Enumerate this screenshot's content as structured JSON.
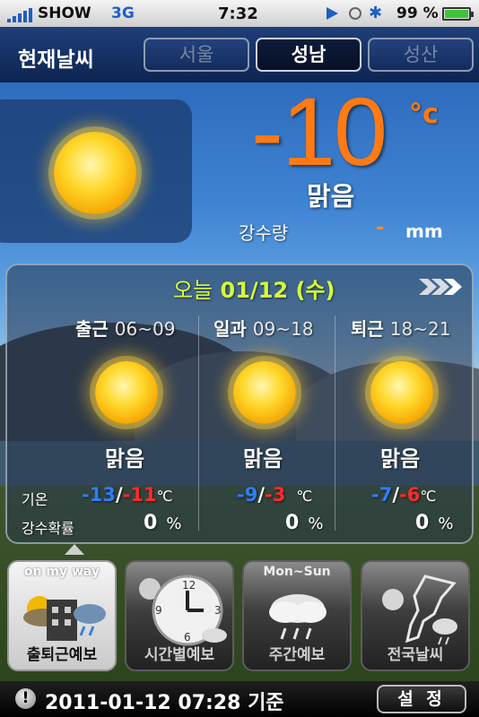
{
  "status_bar": {
    "carrier": "SHOW",
    "network": "3G",
    "time": "7:32",
    "battery_text": "99 %"
  },
  "header": {
    "title": "현재날씨",
    "city_tabs": [
      {
        "label": "서울",
        "active": false
      },
      {
        "label": "성남",
        "active": true
      },
      {
        "label": "성산",
        "active": false
      }
    ]
  },
  "current": {
    "temperature": "-10",
    "unit": "°c",
    "condition": "맑음",
    "precip_label": "강수량",
    "precip_value": "-",
    "precip_unit": "mm"
  },
  "today": {
    "label": "오늘",
    "date": "01/12 (수)",
    "row_labels": {
      "temp": "기온",
      "precip_prob": "강수확률"
    },
    "columns": [
      {
        "period": "출근",
        "hours": "06~09",
        "condition": "맑음",
        "low": "-13",
        "high": "-11",
        "deg": "℃",
        "prob": "0",
        "prob_unit": "%"
      },
      {
        "period": "일과",
        "hours": "09~18",
        "condition": "맑음",
        "low": "-9",
        "high": "-3",
        "deg": "℃",
        "prob": "0",
        "prob_unit": "%"
      },
      {
        "period": "퇴근",
        "hours": "18~21",
        "condition": "맑음",
        "low": "-7",
        "high": "-6",
        "deg": "℃",
        "prob": "0",
        "prob_unit": "%"
      }
    ]
  },
  "tabs": [
    {
      "label": "출퇴근예보",
      "top": "on my way",
      "active": true,
      "icon": "commute-weather-icon"
    },
    {
      "label": "시간별예보",
      "top": "",
      "active": false,
      "icon": "clock-weather-icon"
    },
    {
      "label": "주간예보",
      "top": "Mon~Sun",
      "active": false,
      "icon": "rain-cloud-icon"
    },
    {
      "label": "전국날씨",
      "top": "",
      "active": false,
      "icon": "korea-map-weather-icon"
    }
  ],
  "footer": {
    "timestamp": "2011-01-12 07:28 기준",
    "settings_label": "설 정"
  },
  "colors": {
    "accent_orange": "#ff7a14",
    "low_temp": "#2f7dff",
    "high_temp": "#ff2b2b",
    "date_green": "#d7ff3a"
  }
}
